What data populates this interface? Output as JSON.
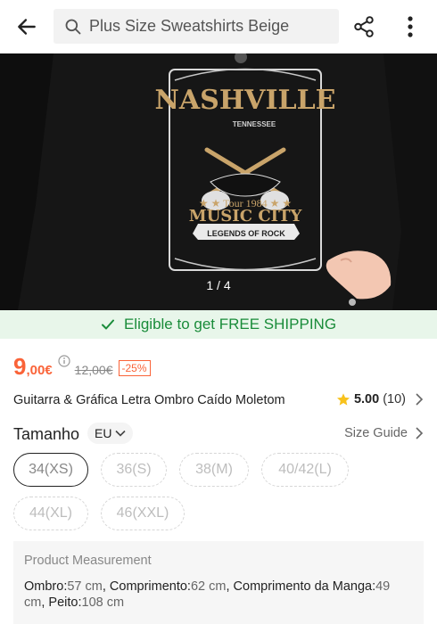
{
  "header": {
    "search_placeholder": "Plus Size Sweatshirts Beige"
  },
  "gallery": {
    "counter": "1 / 4",
    "graphic": {
      "title": "NASHVILLE",
      "subtitle": "TENNESSEE",
      "tour": "★ ★ Tour 1984 ★ ★",
      "headline": "MUSIC CITY",
      "banner": "LEGENDS OF ROCK"
    }
  },
  "shipping": {
    "text": "Eligible to get FREE SHIPPING"
  },
  "price": {
    "current_main": "9",
    "current_cents": ",00€",
    "original": "12,00€",
    "discount": "-25%"
  },
  "product": {
    "title": "Guitarra & Gráfica Letra Ombro Caído Moletom",
    "rating": "5.00",
    "review_count": "(10)"
  },
  "size": {
    "label": "Tamanho",
    "region": "EU",
    "guide": "Size Guide",
    "options": [
      "34(XS)",
      "36(S)",
      "38(M)",
      "40/42(L)",
      "44(XL)",
      "46(XXL)"
    ],
    "selected": "34(XS)"
  },
  "measurement": {
    "title": "Product Measurement",
    "ombro_label": "Ombro:",
    "ombro_value": "57 cm",
    "comprimento_label": "Comprimento:",
    "comprimento_value": "62 cm",
    "manga_label": "Comprimento da Manga:",
    "manga_value": "49 cm",
    "peito_label": "Peito:",
    "peito_value": "108 cm"
  },
  "colors": {
    "accent": "#fa6338",
    "shipping_green": "#1a8c3a",
    "shipping_bg": "#e8f6ea"
  }
}
